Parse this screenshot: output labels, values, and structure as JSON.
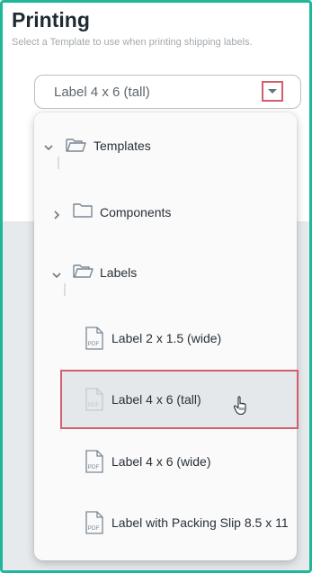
{
  "header": {
    "title": "Printing",
    "subtitle": "Select a Template to use when printing shipping labels."
  },
  "select": {
    "value": "Label 4 x 6 (tall)"
  },
  "tree": {
    "templates": "Templates",
    "components": "Components",
    "labels": "Labels",
    "items": [
      "Label 2 x 1.5 (wide)",
      "Label 4 x 6 (tall)",
      "Label 4 x 6 (wide)",
      "Label with Packing Slip 8.5 x 11"
    ],
    "pdf_icon_text": "PDF",
    "selected_index": 1
  },
  "colors": {
    "frame_border": "#1fb79a",
    "highlight_border": "#d35e6d",
    "selected_bg": "#e5e8ea",
    "icon": "#7b8894"
  }
}
